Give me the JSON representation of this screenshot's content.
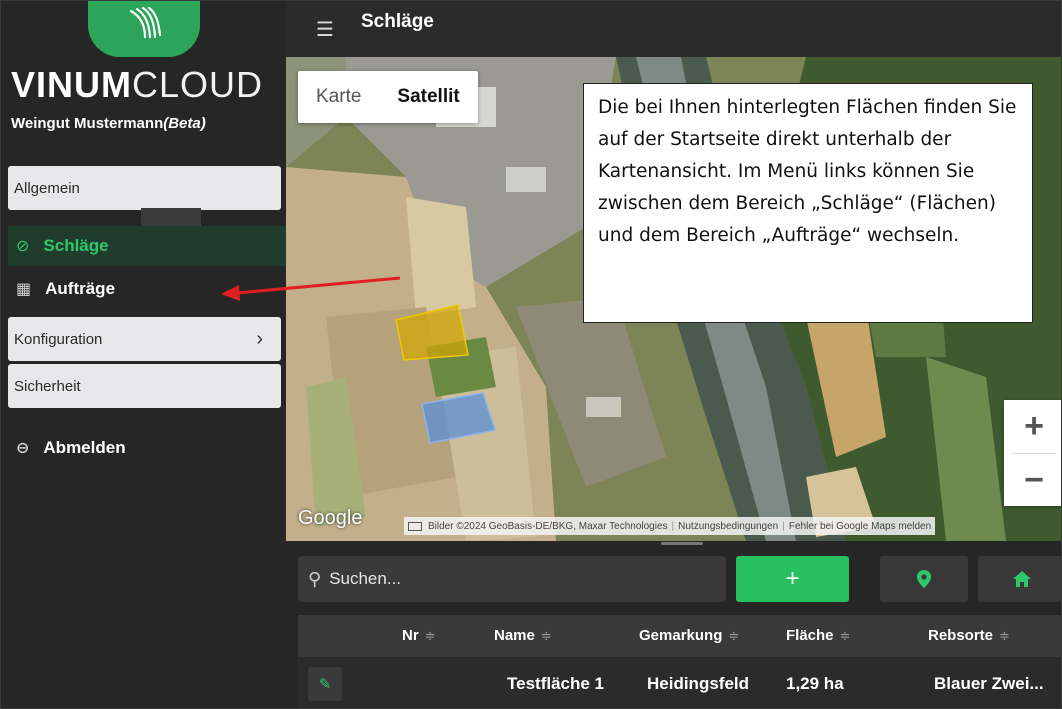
{
  "brand": {
    "name_bold": "VINUM",
    "name_light": "CLOUD",
    "company": "Weingut Mustermann",
    "company_tag": "(Beta)"
  },
  "sidebar": {
    "sections": [
      {
        "label": "Allgemein"
      },
      {
        "label": "Konfiguration",
        "chevron": "›"
      },
      {
        "label": "Sicherheit"
      }
    ],
    "items": [
      {
        "label": "Schläge",
        "icon": "leaf-icon",
        "active": true
      },
      {
        "label": "Aufträge",
        "icon": "calendar-icon"
      },
      {
        "label": "Abmelden",
        "icon": "logout-icon"
      }
    ]
  },
  "header": {
    "title": "Schläge",
    "menu_icon": "hamburger-icon"
  },
  "map": {
    "type_options": [
      "Karte",
      "Satellit"
    ],
    "selected_type": "Satellit",
    "zoom_in": "+",
    "zoom_out": "−",
    "google_logo": "Google",
    "attribution": [
      "Bilder ©2024 GeoBasis-DE/BKG, Maxar Technologies",
      "Nutzungsbedingungen",
      "Fehler bei Google Maps melden"
    ],
    "field_colors": {
      "field_1": "#d4a800",
      "field_2": "#5a8fd6"
    }
  },
  "callout": {
    "text": "Die bei Ihnen hinterlegten Flächen finden Sie auf der Startseite direkt unterhalb der Kartenansicht. Im Menü links können Sie zwischen dem Bereich „Schläge“ (Flächen) und dem Bereich „Aufträge“ wechseln."
  },
  "toolbar": {
    "search_placeholder": "Suchen...",
    "add_label": "+",
    "location_icon": "map-pin-icon",
    "home_icon": "home-icon"
  },
  "table": {
    "columns": [
      "Nr",
      "Name",
      "Gemarkung",
      "Fläche",
      "Rebsorte"
    ],
    "sort_glyph": "≑",
    "rows": [
      {
        "nr": "",
        "name": "Testfläche 1",
        "gemarkung": "Heidingsfeld",
        "flaeche": "1,29 ha",
        "rebsorte": "Blauer Zwei..."
      }
    ]
  },
  "colors": {
    "accent": "#2ec86b",
    "sidebar_bg": "#262626",
    "arrow": "#e02020"
  }
}
